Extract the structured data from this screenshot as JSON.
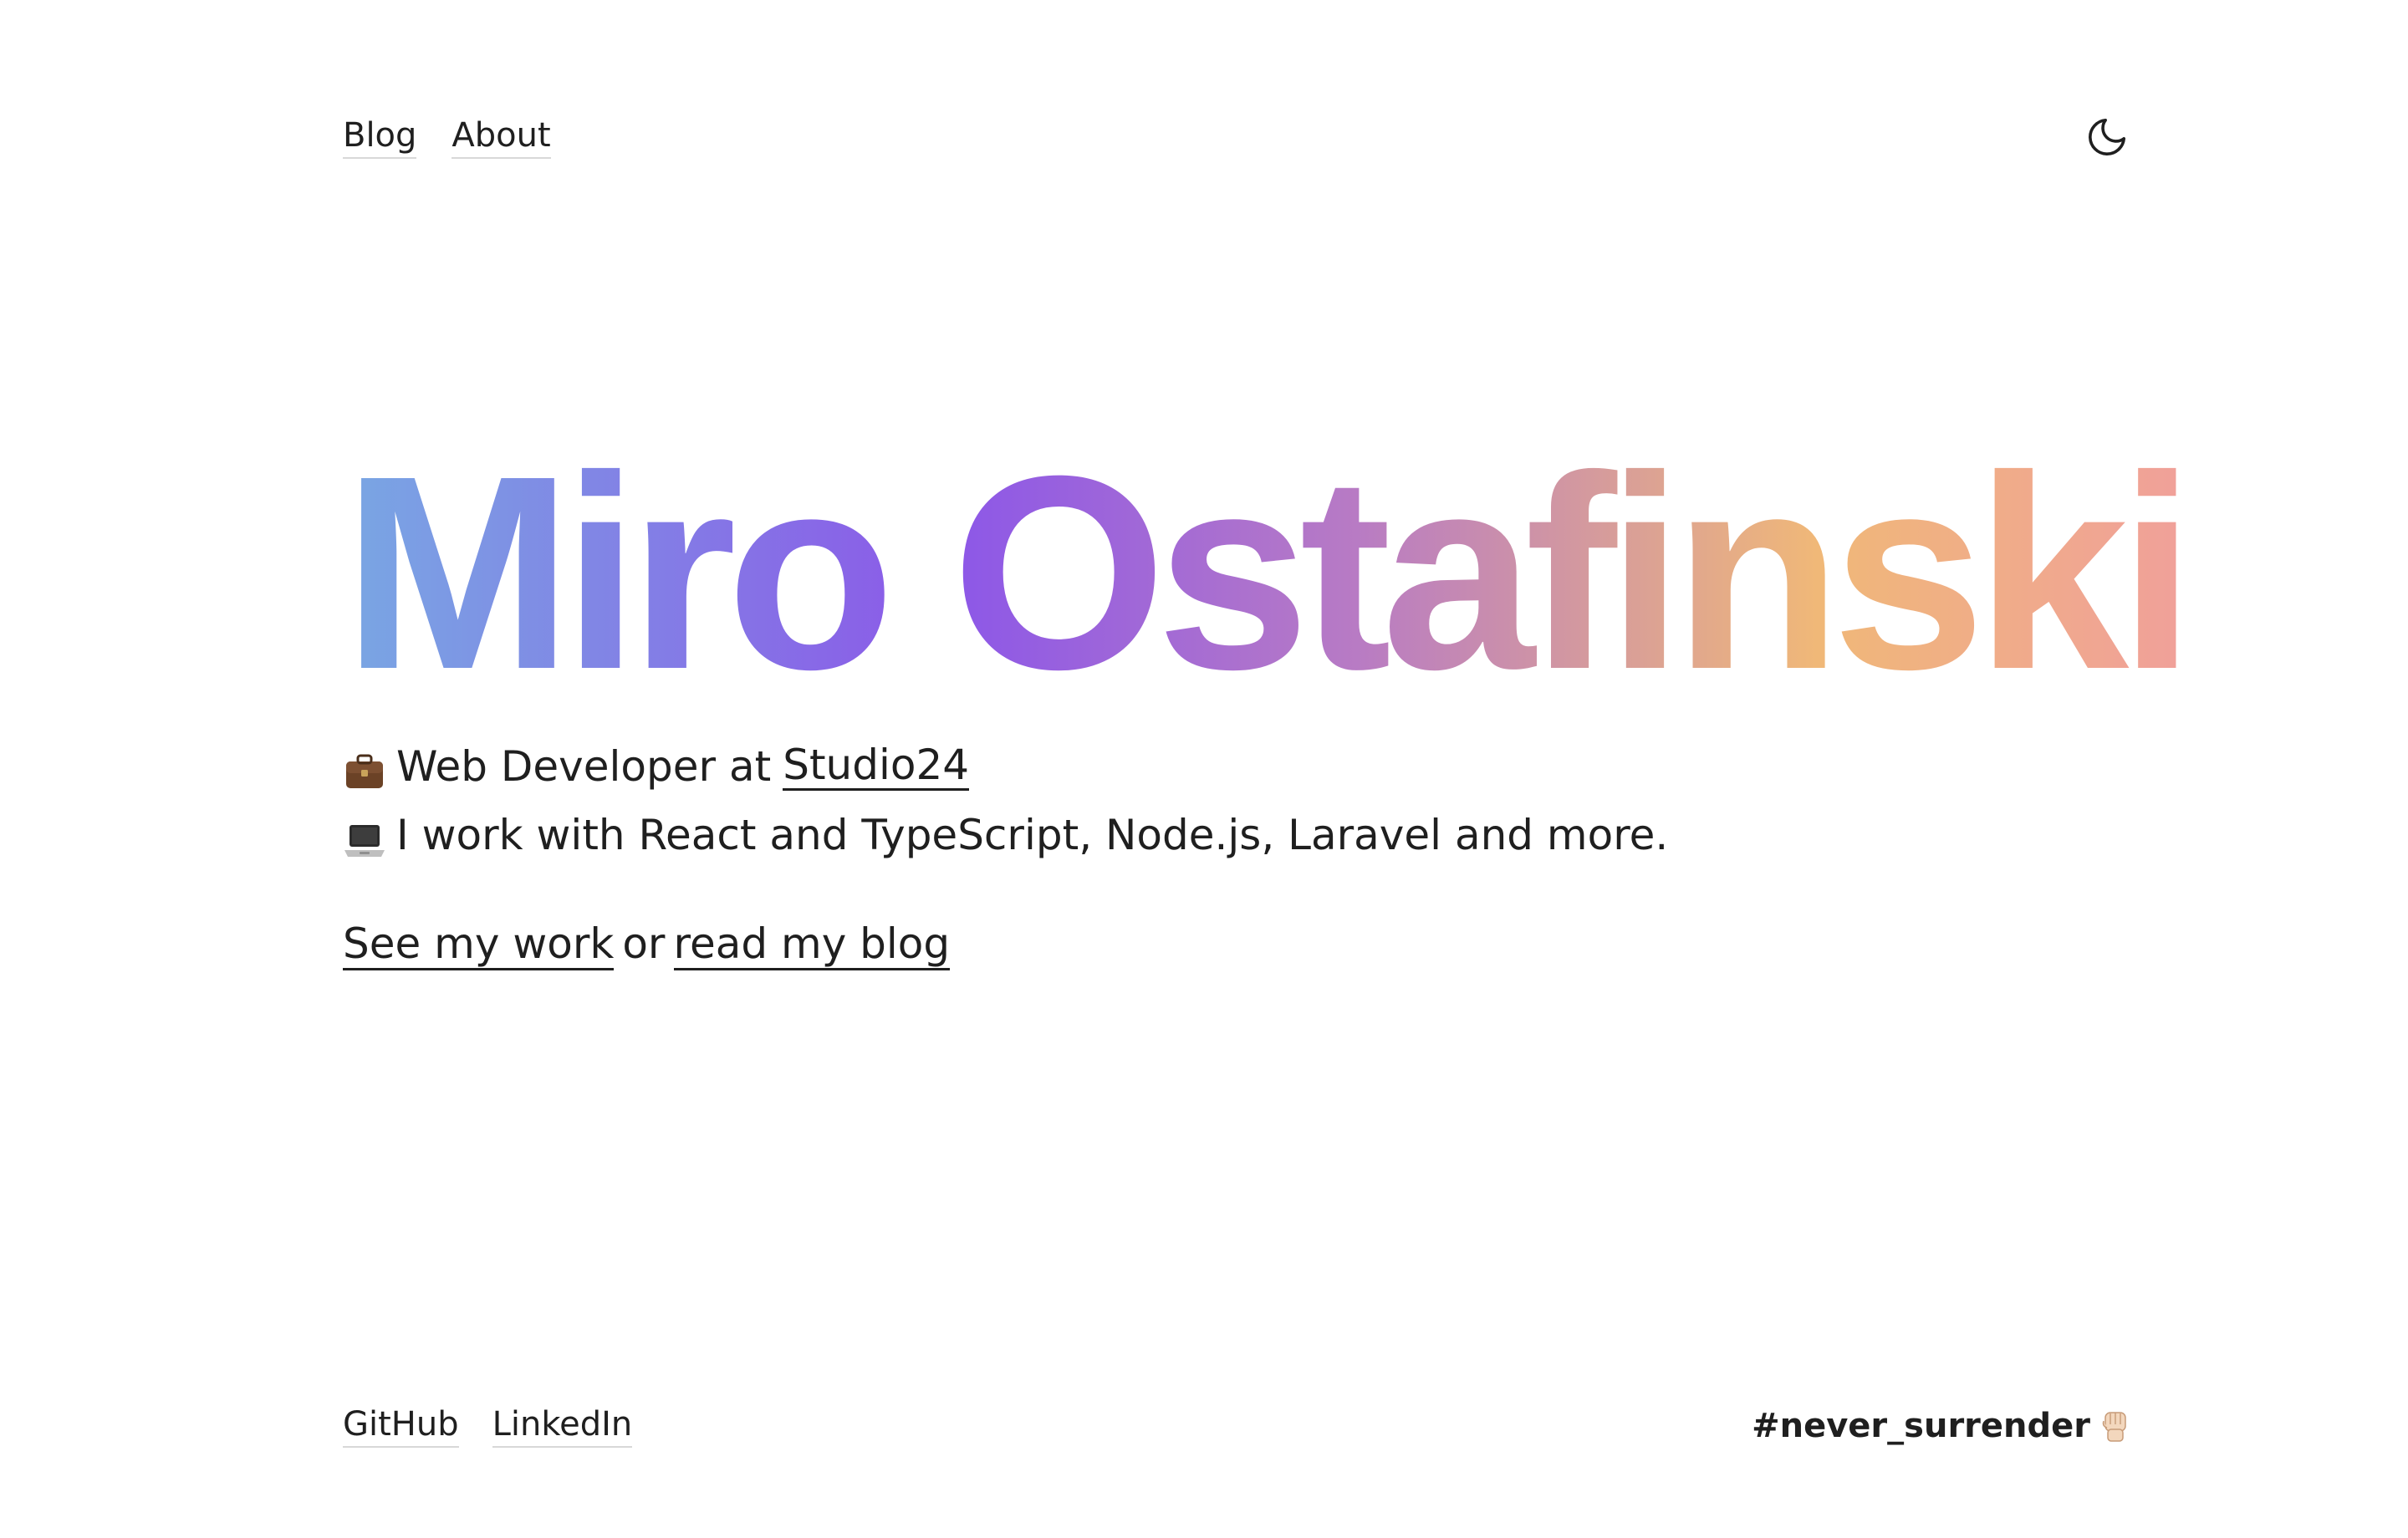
{
  "nav": {
    "items": [
      {
        "label": "Blog"
      },
      {
        "label": "About"
      }
    ]
  },
  "theme_toggle": {
    "icon": "moon-icon"
  },
  "hero": {
    "title": "Miro Ostafinski",
    "gradient_colors": [
      "#79a7e3",
      "#8c57e8",
      "#b87bc4",
      "#f0b878",
      "#f0a09a"
    ]
  },
  "intro": {
    "line1_icon": "briefcase-icon",
    "line1_text": "Web Developer at",
    "line1_link": "Studio24",
    "line2_icon": "laptop-icon",
    "line2_text": "I work with React and TypeScript, Node.js, Laravel and more."
  },
  "cta": {
    "work_link": "See my work",
    "or_text": "or",
    "blog_link": "read my blog"
  },
  "footer": {
    "links": [
      {
        "label": "GitHub"
      },
      {
        "label": "LinkedIn"
      }
    ],
    "hashtag": "#never_surrender",
    "hashtag_icon": "raised-fist-icon"
  }
}
